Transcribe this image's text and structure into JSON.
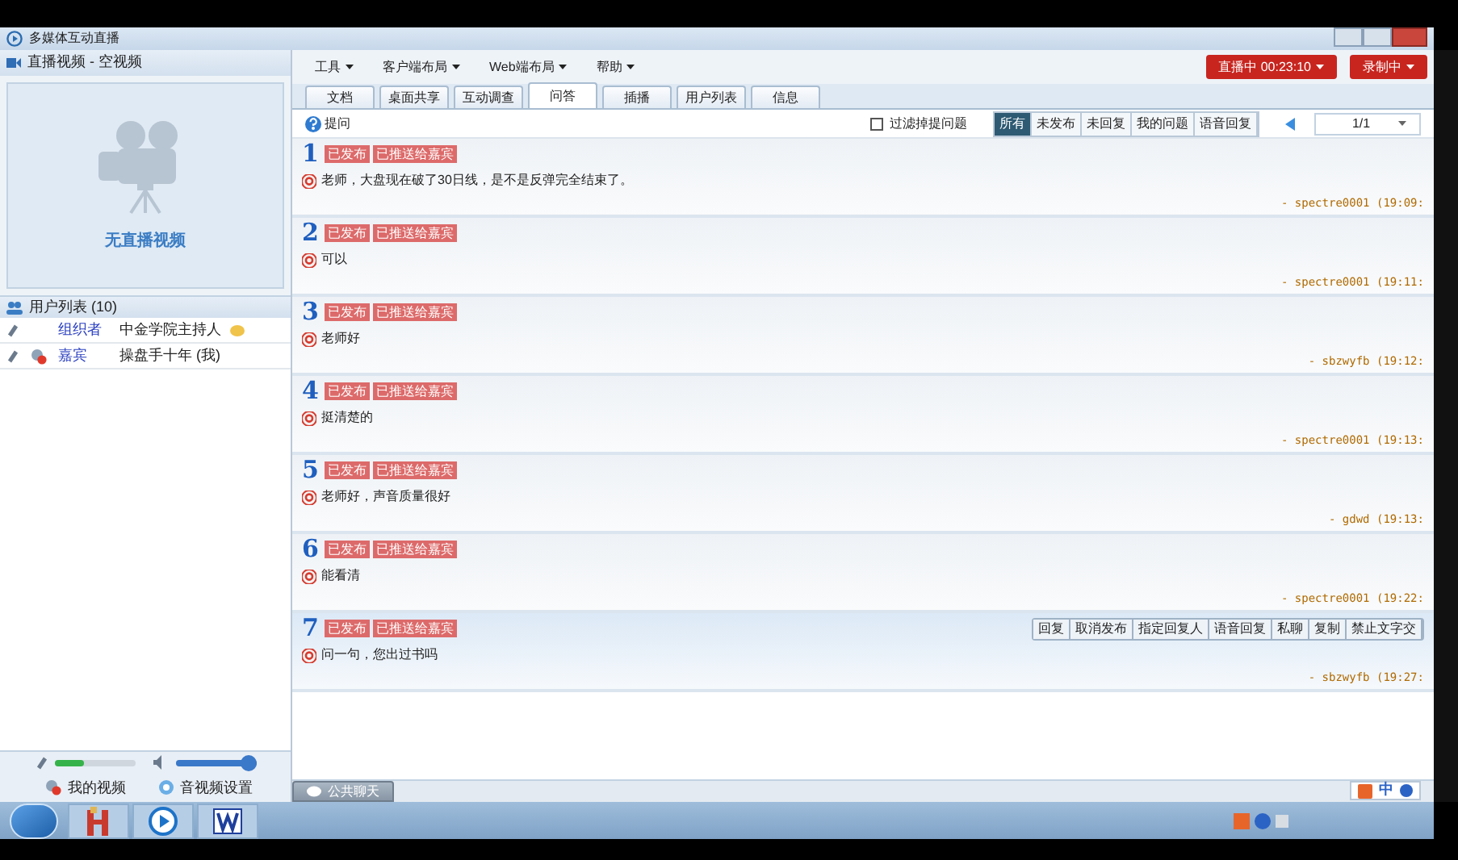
{
  "window": {
    "title": "多媒体互动直播"
  },
  "video_panel": {
    "title": "直播视频 - 空视频",
    "placeholder": "无直播视频"
  },
  "user_list": {
    "title": "用户列表 (10)",
    "users": [
      {
        "kind": "organizer",
        "role": "组织者",
        "name": "中金学院主持人"
      },
      {
        "kind": "guest",
        "role": "嘉宾",
        "name": "操盘手十年 (我)"
      }
    ]
  },
  "av_controls": {
    "mic": {
      "level": 0.35
    },
    "speaker": {
      "level": 1
    },
    "my_video": "我的视频",
    "settings": "音视频设置"
  },
  "menu": [
    "工具",
    "客户端布局",
    "Web端布局",
    "帮助"
  ],
  "live_button": "直播中 00:23:10",
  "record_button": "录制中",
  "tabs": [
    {
      "label": "文档",
      "selected": false
    },
    {
      "label": "桌面共享",
      "selected": false
    },
    {
      "label": "互动调查",
      "selected": false
    },
    {
      "label": "问答",
      "selected": true
    },
    {
      "label": "插播",
      "selected": false
    },
    {
      "label": "用户列表",
      "selected": false
    },
    {
      "label": "信息",
      "selected": false
    }
  ],
  "qa_toolbar": {
    "ask": "提问",
    "filter": {
      "label": "过滤掉提问题",
      "checked": false
    },
    "filters": [
      {
        "label": "所有",
        "selected": true
      },
      {
        "label": "未发布",
        "selected": false
      },
      {
        "label": "未回复",
        "selected": false
      },
      {
        "label": "我的问题",
        "selected": false
      },
      {
        "label": "语音回复",
        "selected": false
      }
    ],
    "page": "1/1"
  },
  "questions": [
    {
      "number": "1",
      "tags": [
        "已发布",
        "已推送给嘉宾"
      ],
      "text": "老师，大盘现在破了30日线，是不是反弹完全结束了。",
      "author": "- spectre0001 (19:09:",
      "selected": false
    },
    {
      "number": "2",
      "tags": [
        "已发布",
        "已推送给嘉宾"
      ],
      "text": "可以",
      "author": "- spectre0001 (19:11:",
      "selected": false
    },
    {
      "number": "3",
      "tags": [
        "已发布",
        "已推送给嘉宾"
      ],
      "text": "老师好",
      "author": "- sbzwyfb (19:12:",
      "selected": false
    },
    {
      "number": "4",
      "tags": [
        "已发布",
        "已推送给嘉宾"
      ],
      "text": "挺清楚的",
      "author": "- spectre0001 (19:13:",
      "selected": false
    },
    {
      "number": "5",
      "tags": [
        "已发布",
        "已推送给嘉宾"
      ],
      "text": "老师好，声音质量很好",
      "author": "- gdwd (19:13:",
      "selected": false
    },
    {
      "number": "6",
      "tags": [
        "已发布",
        "已推送给嘉宾"
      ],
      "text": "能看清",
      "author": "- spectre0001 (19:22:",
      "selected": false
    },
    {
      "number": "7",
      "tags": [
        "已发布",
        "已推送给嘉宾"
      ],
      "text": "问一句，您出过书吗",
      "author": "- sbzwyfb (19:27:",
      "selected": true,
      "actions": [
        "回复",
        "取消发布",
        "指定回复人",
        "语音回复",
        "私聊",
        "复制",
        "禁止文字交"
      ]
    }
  ],
  "chat_tab": "公共聊天",
  "tray": {
    "ime": "中"
  }
}
